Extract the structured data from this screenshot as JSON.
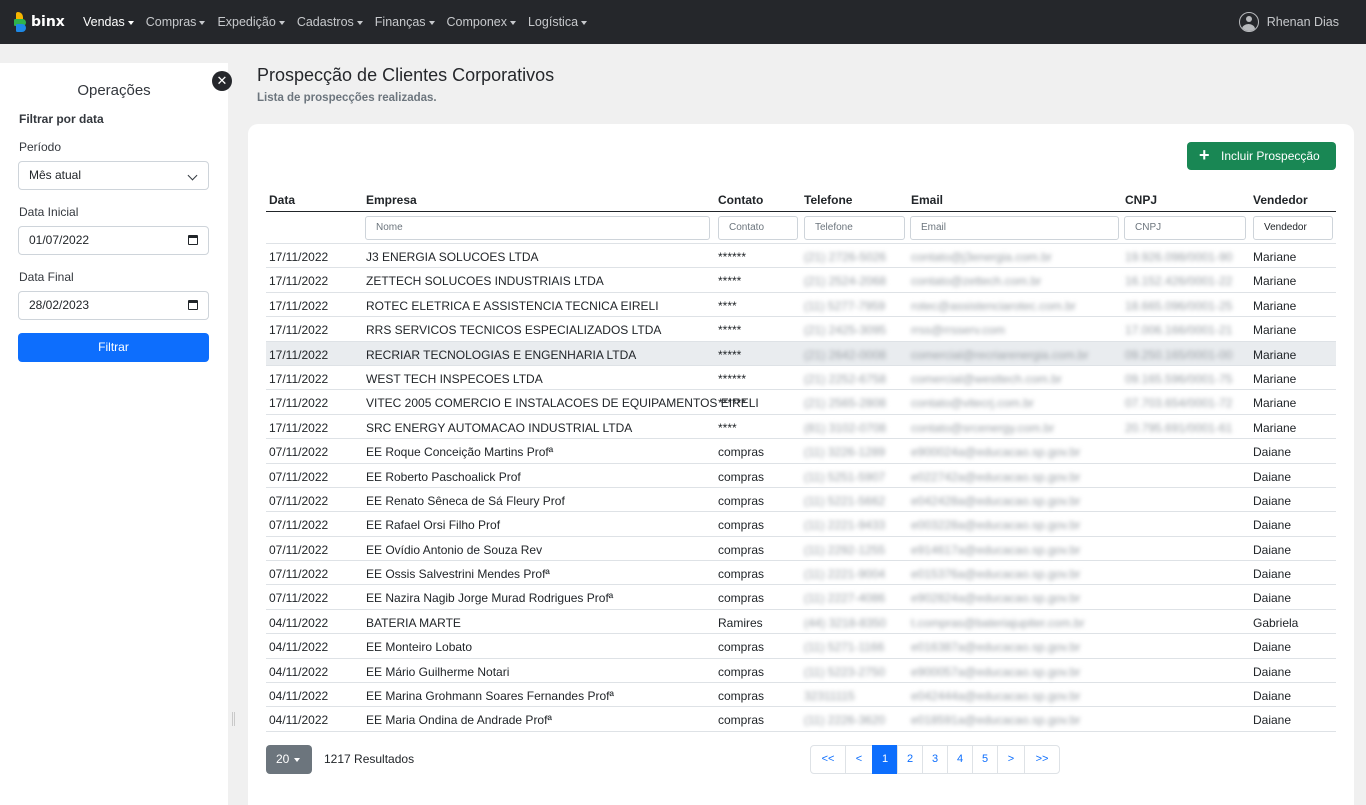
{
  "navbar": {
    "brand": "binx",
    "menus": [
      "Vendas",
      "Compras",
      "Expedição",
      "Cadastros",
      "Finanças",
      "Componex",
      "Logística"
    ],
    "active_menu": "Vendas",
    "user_name": "Rhenan Dias"
  },
  "sidebar": {
    "close_icon": "close-icon",
    "title": "Operações",
    "filter_heading": "Filtrar por data",
    "periodo_label": "Período",
    "periodo_value": "Mês atual",
    "data_inicial_label": "Data Inicial",
    "data_inicial_value": "01/07/2022",
    "data_final_label": "Data Final",
    "data_final_value": "28/02/2023",
    "filter_button": "Filtrar"
  },
  "page": {
    "title": "Prospecção de Clientes Corporativos",
    "subtitle": "Lista de prospecções realizadas.",
    "add_button": "Incluir Prospecção"
  },
  "table": {
    "columns": [
      "Data",
      "Empresa",
      "Contato",
      "Telefone",
      "Email",
      "CNPJ",
      "Vendedor"
    ],
    "filters": [
      "Nome",
      "Contato",
      "Telefone",
      "Email",
      "CNPJ",
      "Vendedor"
    ],
    "highlighted_row": 4,
    "rows": [
      {
        "data": "17/11/2022",
        "empresa": "J3 ENERGIA SOLUCOES LTDA",
        "contato": "******",
        "telefone": "(21) 2726-5026",
        "email": "contato@j3energia.com.br",
        "cnpj": "19.926.098/0001-90",
        "vendedor": "Mariane"
      },
      {
        "data": "17/11/2022",
        "empresa": "ZETTECH SOLUCOES INDUSTRIAIS LTDA",
        "contato": "*****",
        "telefone": "(21) 2524-2068",
        "email": "contato@zettech.com.br",
        "cnpj": "16.152.426/0001-22",
        "vendedor": "Mariane"
      },
      {
        "data": "17/11/2022",
        "empresa": "ROTEC ELETRICA E ASSISTENCIA TECNICA EIRELI",
        "contato": "****",
        "telefone": "(11) 5277-7959",
        "email": "rotec@assistenciarotec.com.br",
        "cnpj": "18.665.096/0001-25",
        "vendedor": "Mariane"
      },
      {
        "data": "17/11/2022",
        "empresa": "RRS SERVICOS TECNICOS ESPECIALIZADOS LTDA",
        "contato": "*****",
        "telefone": "(21) 2425-3095",
        "email": "rrss@rrsserv.com",
        "cnpj": "17.006.166/0001-21",
        "vendedor": "Mariane"
      },
      {
        "data": "17/11/2022",
        "empresa": "RECRIAR TECNOLOGIAS E ENGENHARIA LTDA",
        "contato": "*****",
        "telefone": "(21) 2642-0008",
        "email": "comercial@recriarenergia.com.br",
        "cnpj": "09.250.165/0001-00",
        "vendedor": "Mariane"
      },
      {
        "data": "17/11/2022",
        "empresa": "WEST TECH INSPECOES LTDA",
        "contato": "******",
        "telefone": "(21) 2252-6758",
        "email": "comercial@westtech.com.br",
        "cnpj": "09.165.596/0001-75",
        "vendedor": "Mariane"
      },
      {
        "data": "17/11/2022",
        "empresa": "VITEC 2005 COMERCIO E INSTALACOES DE EQUIPAMENTOS EIRELI",
        "contato": "******",
        "telefone": "(21) 2565-2808",
        "email": "contato@vitecrj.com.br",
        "cnpj": "07.703.654/0001-72",
        "vendedor": "Mariane"
      },
      {
        "data": "17/11/2022",
        "empresa": "SRC ENERGY AUTOMACAO INDUSTRIAL LTDA",
        "contato": "****",
        "telefone": "(81) 3102-0708",
        "email": "contato@srcenergy.com.br",
        "cnpj": "20.795.691/0001-61",
        "vendedor": "Mariane"
      },
      {
        "data": "07/11/2022",
        "empresa": "EE Roque Conceição Martins Profª",
        "contato": "compras",
        "telefone": "(11) 3226-1289",
        "email": "e900024a@educacao.sp.gov.br",
        "cnpj": "",
        "vendedor": "Daiane"
      },
      {
        "data": "07/11/2022",
        "empresa": "EE Roberto Paschoalick Prof",
        "contato": "compras",
        "telefone": "(11) 5251-5907",
        "email": "e022742a@educacao.sp.gov.br",
        "cnpj": "",
        "vendedor": "Daiane"
      },
      {
        "data": "07/11/2022",
        "empresa": "EE Renato Sêneca de Sá Fleury Prof",
        "contato": "compras",
        "telefone": "(11) 5221-5662",
        "email": "e042428a@educacao.sp.gov.br",
        "cnpj": "",
        "vendedor": "Daiane"
      },
      {
        "data": "07/11/2022",
        "empresa": "EE Rafael Orsi Filho Prof",
        "contato": "compras",
        "telefone": "(11) 2221-9433",
        "email": "e003228a@educacao.sp.gov.br",
        "cnpj": "",
        "vendedor": "Daiane"
      },
      {
        "data": "07/11/2022",
        "empresa": "EE Ovídio Antonio de Souza Rev",
        "contato": "compras",
        "telefone": "(11) 2292-1255",
        "email": "e914617a@educacao.sp.gov.br",
        "cnpj": "",
        "vendedor": "Daiane"
      },
      {
        "data": "07/11/2022",
        "empresa": "EE Ossis Salvestrini Mendes Profª",
        "contato": "compras",
        "telefone": "(11) 2221-9004",
        "email": "e015376a@educacao.sp.gov.br",
        "cnpj": "",
        "vendedor": "Daiane"
      },
      {
        "data": "07/11/2022",
        "empresa": "EE Nazira Nagib Jorge Murad Rodrigues Profª",
        "contato": "compras",
        "telefone": "(11) 2227-4086",
        "email": "e902824a@educacao.sp.gov.br",
        "cnpj": "",
        "vendedor": "Daiane"
      },
      {
        "data": "04/11/2022",
        "empresa": "BATERIA MARTE",
        "contato": "Ramires",
        "telefone": "(44) 3218-8350",
        "email": "t.compras@bateriajupiter.com.br",
        "cnpj": "",
        "vendedor": "Gabriela"
      },
      {
        "data": "04/11/2022",
        "empresa": "EE Monteiro Lobato",
        "contato": "compras",
        "telefone": "(11) 5271-1166",
        "email": "e016387a@educacao.sp.gov.br",
        "cnpj": "",
        "vendedor": "Daiane"
      },
      {
        "data": "04/11/2022",
        "empresa": "EE Mário Guilherme Notari",
        "contato": "compras",
        "telefone": "(11) 5223-2750",
        "email": "e900057a@educacao.sp.gov.br",
        "cnpj": "",
        "vendedor": "Daiane"
      },
      {
        "data": "04/11/2022",
        "empresa": "EE Marina Grohmann Soares Fernandes Profª",
        "contato": "compras",
        "telefone": "32311115",
        "email": "e042444a@educacao.sp.gov.br",
        "cnpj": "",
        "vendedor": "Daiane"
      },
      {
        "data": "04/11/2022",
        "empresa": "EE Maria Ondina de Andrade Profª",
        "contato": "compras",
        "telefone": "(11) 2226-3620",
        "email": "e018591a@educacao.sp.gov.br",
        "cnpj": "",
        "vendedor": "Daiane"
      }
    ]
  },
  "footer": {
    "page_size": "20",
    "results": "1217 Resultados",
    "pagination": [
      "<<",
      "<",
      "1",
      "2",
      "3",
      "4",
      "5",
      ">",
      ">>"
    ],
    "active_page": "1"
  }
}
